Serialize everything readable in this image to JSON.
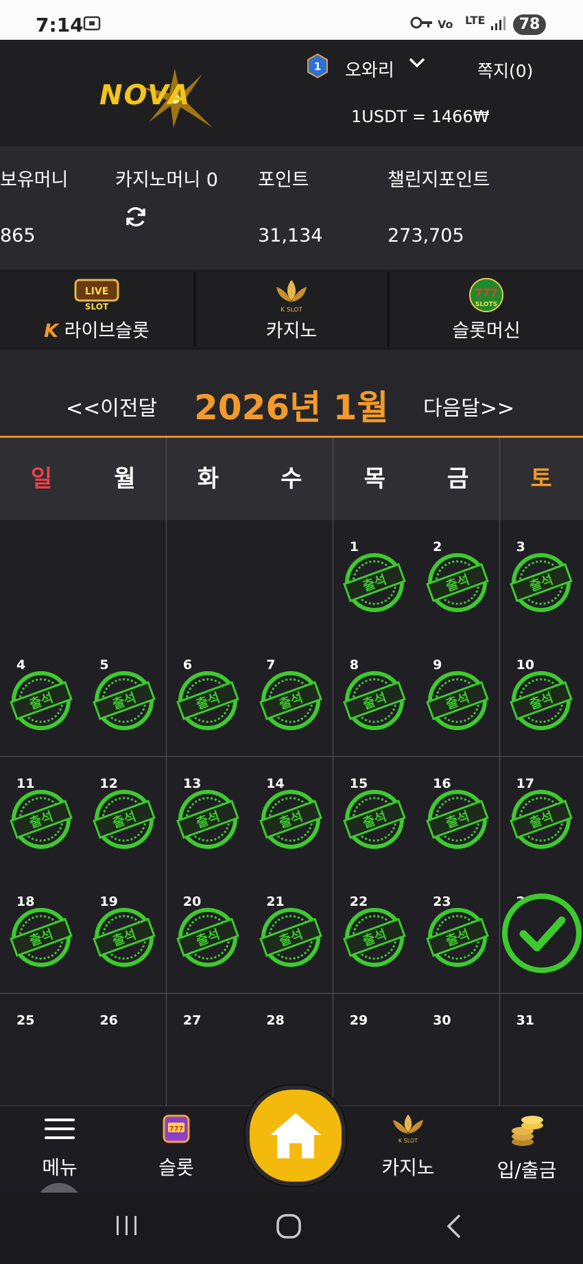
{
  "statusbar": {
    "time": "7:14",
    "network": "LTE",
    "battery": "78"
  },
  "header": {
    "logo_text": "NOVA",
    "user_level": "1",
    "username": "오와리",
    "messages": "쪽지(0)",
    "exchange_rate": "1USDT = 1466₩"
  },
  "balances": {
    "holding_label": "보유머니",
    "holding_value": "865",
    "casino_label": "카지노머니 0",
    "point_label": "포인트",
    "point_value": "31,134",
    "challenge_label": "챌린지포인트",
    "challenge_value": "273,705"
  },
  "categories": [
    {
      "label": "라이브슬롯",
      "badge": "LIVE SLOT"
    },
    {
      "label": "카지노",
      "badge": "K SLOT"
    },
    {
      "label": "슬롯머신",
      "badge": "777 SLOTS"
    }
  ],
  "monthnav": {
    "prev": "<<이전달",
    "title": "2026년 1월",
    "next": "다음달>>"
  },
  "weekdays": [
    "일",
    "월",
    "화",
    "수",
    "목",
    "금",
    "토"
  ],
  "stamp_text": "출석",
  "calendar_rows": [
    [
      "",
      "",
      "",
      "",
      "1",
      "2",
      "3"
    ],
    [
      "4",
      "5",
      "6",
      "7",
      "8",
      "9",
      "10"
    ],
    [
      "11",
      "12",
      "13",
      "14",
      "15",
      "16",
      "17"
    ],
    [
      "18",
      "19",
      "20",
      "21",
      "22",
      "23",
      "24"
    ],
    [
      "25",
      "26",
      "27",
      "28",
      "29",
      "30",
      "31"
    ]
  ],
  "attended_days": [
    "1",
    "2",
    "3",
    "4",
    "5",
    "6",
    "7",
    "8",
    "9",
    "10",
    "11",
    "12",
    "13",
    "14",
    "15",
    "16",
    "17",
    "18",
    "19",
    "20",
    "21",
    "22",
    "23"
  ],
  "today_checked": "24",
  "bottomnav": {
    "menu": "메뉴",
    "slot": "슬롯",
    "casino": "카지노",
    "deposit": "입/출금"
  },
  "colors": {
    "accent": "#f39a2a",
    "sunday": "#e8404a",
    "saturday": "#f39a2a",
    "stamp": "#3ec92f"
  }
}
